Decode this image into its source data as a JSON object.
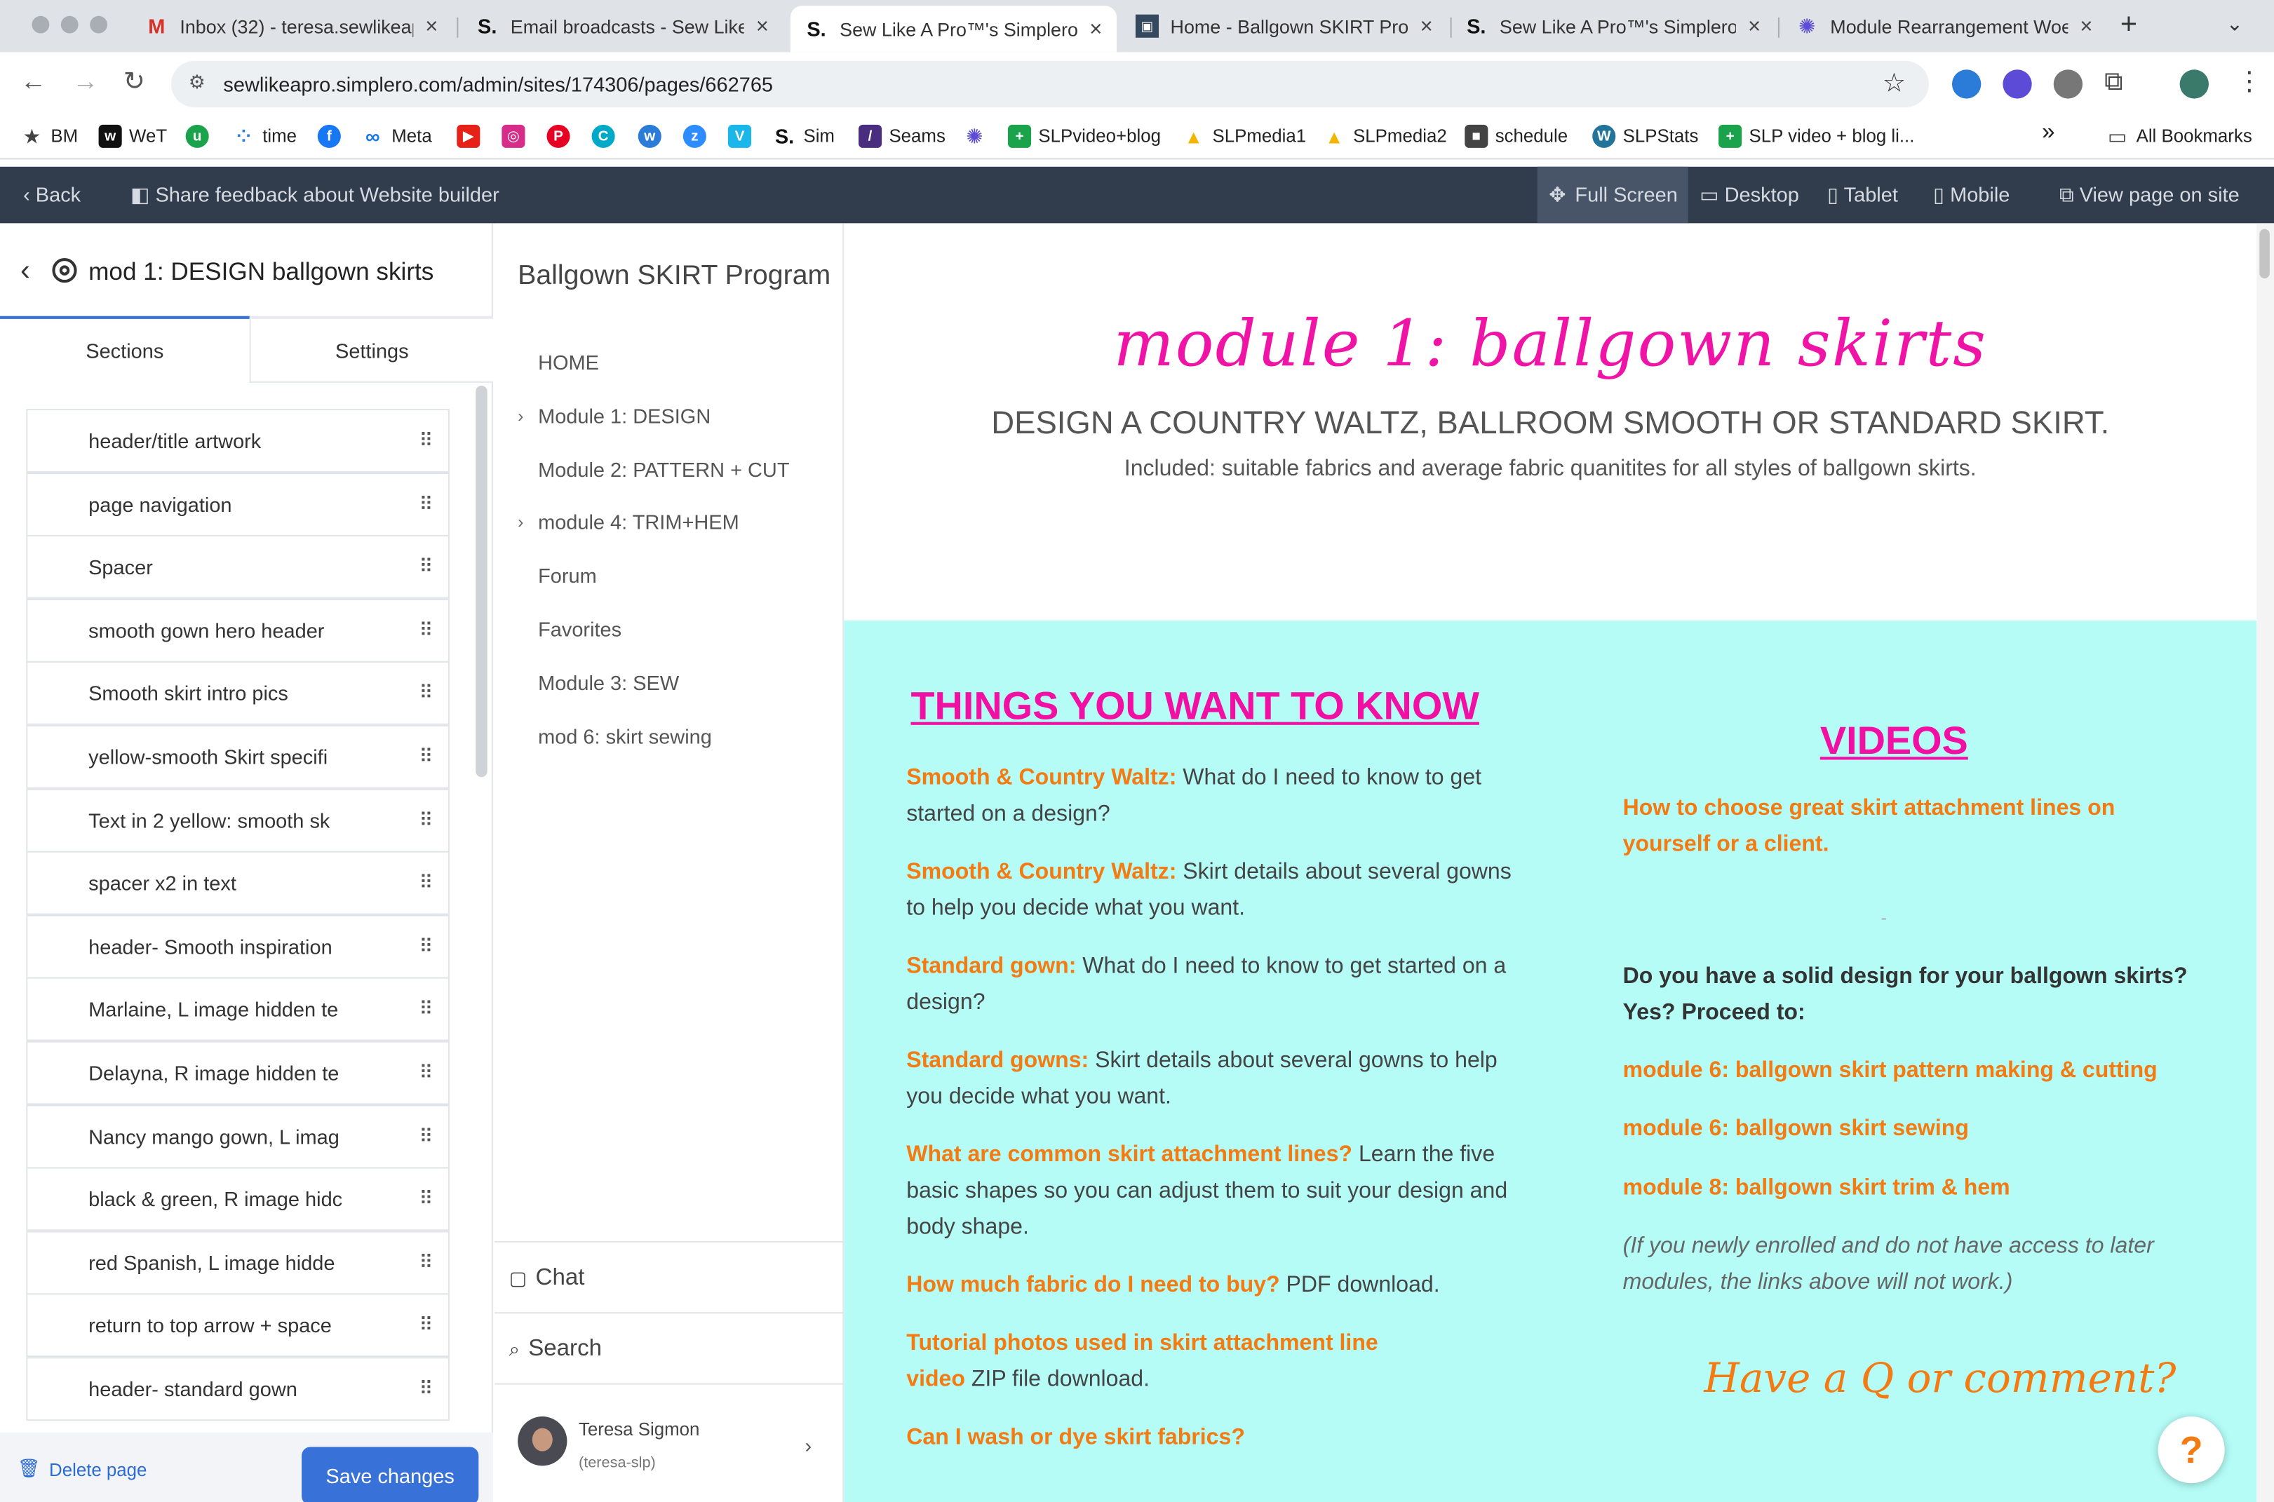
{
  "browser": {
    "tabs": [
      {
        "title": "Inbox (32) - teresa.sewlikeap",
        "favicon": "gmail-icon",
        "color": "#d93025"
      },
      {
        "title": "Email broadcasts - Sew Like",
        "favicon": "simplero-icon",
        "color": "#222222"
      },
      {
        "title": "Sew Like A Pro™'s Simplero",
        "favicon": "simplero-icon",
        "color": "#222222"
      },
      {
        "title": "Home - Ballgown SKIRT Prog",
        "favicon": "photo-icon",
        "color": "#333333"
      },
      {
        "title": "Sew Like A Pro™'s Simplero",
        "favicon": "simplero-icon",
        "color": "#222222"
      },
      {
        "title": "Module Rearrangement Woe",
        "favicon": "sparkle-icon",
        "color": "#5b4bd6"
      }
    ],
    "url": "sewlikeapro.simplero.com/admin/sites/174306/pages/662765",
    "bookmarks": [
      "BM",
      "WeT",
      "",
      "time",
      "",
      "Meta",
      "",
      "",
      "",
      "",
      "",
      "",
      "",
      "Sim",
      "Seams",
      "",
      "SLPvideo+blog",
      "SLPmedia1",
      "SLPmedia2",
      "schedule",
      "SLPStats",
      "SLP video + blog li..."
    ],
    "all_bookmarks": "All Bookmarks",
    "overflow": "»"
  },
  "admin_bar": {
    "back": "Back",
    "feedback": "Share feedback about Website builder",
    "full_screen": "Full Screen",
    "desktop": "Desktop",
    "tablet": "Tablet",
    "mobile": "Mobile",
    "view_page": "View page on site"
  },
  "left_panel": {
    "title": "mod 1: DESIGN ballgown skirts",
    "tab_sections": "Sections",
    "tab_settings": "Settings",
    "sections": [
      "header/title artwork",
      "page navigation",
      "Spacer",
      "smooth gown hero header",
      "Smooth skirt intro pics",
      "yellow-smooth Skirt specifi",
      "Text in 2 yellow: smooth sk",
      "spacer x2 in text",
      "header- Smooth inspiration",
      "Marlaine, L image hidden te",
      "Delayna, R image hidden te",
      "Nancy mango gown, L imag",
      "black & green, R image hidc",
      "red Spanish, L image hidde",
      "return to top arrow + space",
      "header- standard gown"
    ],
    "delete": "Delete page",
    "save": "Save changes"
  },
  "course_nav": {
    "title": "Ballgown SKIRT Program",
    "items": [
      {
        "label": "HOME",
        "chevron": false
      },
      {
        "label": "Module 1: DESIGN",
        "chevron": true
      },
      {
        "label": "Module 2: PATTERN + CUT",
        "chevron": false
      },
      {
        "label": "module 4: TRIM+HEM",
        "chevron": true
      },
      {
        "label": "Forum",
        "chevron": false
      },
      {
        "label": "Favorites",
        "chevron": false
      },
      {
        "label": "Module 3: SEW",
        "chevron": false
      },
      {
        "label": "mod 6: skirt sewing",
        "chevron": false
      }
    ],
    "chat": "Chat",
    "search": "Search",
    "user_name": "Teresa Sigmon",
    "user_handle": "(teresa-slp)"
  },
  "preview": {
    "hero_title": "module 1: ballgown skirts",
    "hero_subtitle": "DESIGN A COUNTRY WALTZ, BALLROOM SMOOTH OR STANDARD SKIRT.",
    "hero_included": "Included: suitable fabrics and average fabric quanitites for all styles of ballgown skirts.",
    "left_heading": "THINGS YOU WANT TO KNOW",
    "left_items": [
      {
        "bold": "Smooth & Country Waltz:",
        "text": " What do I need to know to get started on a design?"
      },
      {
        "bold": "Smooth & Country Waltz:",
        "text": " Skirt details about several gowns to help you decide what you want."
      },
      {
        "bold": "Standard gown:",
        "text": " What do I need to know to get started on a design?"
      },
      {
        "bold": "Standard gowns:",
        "text": " Skirt details about several gowns to help you decide what you want."
      },
      {
        "bold": "What are common skirt attachment lines?",
        "text": " Learn the five basic shapes so you can adjust them to suit your design and body shape."
      },
      {
        "bold": "How much fabric do I need to buy?",
        "text": "  PDF download."
      },
      {
        "bold": "Tutorial photos used in skirt attachment line video",
        "text": "  ZIP file download."
      },
      {
        "bold": "Can I wash or dye skirt fabrics?",
        "text": ""
      }
    ],
    "right_heading": "VIDEOS",
    "video_link": "How to choose great skirt attachment lines on yourself or a client.",
    "dash": "-",
    "question": "Do you have a solid design for your ballgown skirts? Yes?  Proceed to:",
    "links": [
      "module 6: ballgown skirt pattern making & cutting",
      "module 6: ballgown skirt sewing",
      "module 8: ballgown skirt trim & hem"
    ],
    "note": "(If you newly enrolled and do not have access to later modules, the links above will not work.)",
    "cta": "Have a Q or comment?",
    "help": "?"
  },
  "colors": {
    "pink": "#f20fa4",
    "orange": "#f47a12",
    "cyan": "#b5fcf7",
    "admin": "#313c4d",
    "save": "#3872d9"
  }
}
